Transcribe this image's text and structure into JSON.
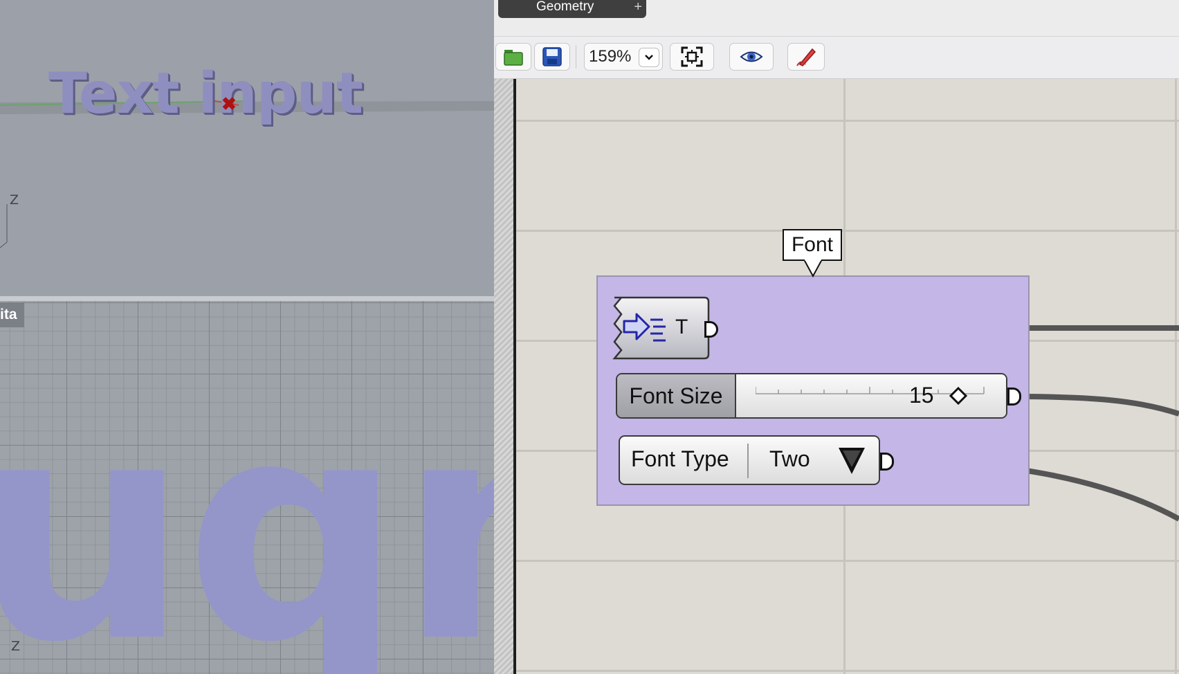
{
  "viewports": {
    "top": {
      "text": "Text input",
      "axis_label": "Z"
    },
    "bottom": {
      "tab_label": "ita",
      "big_text": "uqni",
      "axis_label": "Z"
    }
  },
  "grasshopper": {
    "tab": {
      "label": "Geometry"
    },
    "toolbar": {
      "zoom": "159%",
      "icons": [
        "folder-open-icon",
        "save-disk-icon",
        "zoom-extents-icon",
        "preview-eye-icon",
        "sketch-pen-icon"
      ]
    },
    "canvas": {
      "group_name": "Font",
      "text_param_label": "T",
      "font_size": {
        "label": "Font Size",
        "value": "15",
        "level": 0.82
      },
      "font_type": {
        "label": "Font Type",
        "value": "Two"
      }
    }
  }
}
